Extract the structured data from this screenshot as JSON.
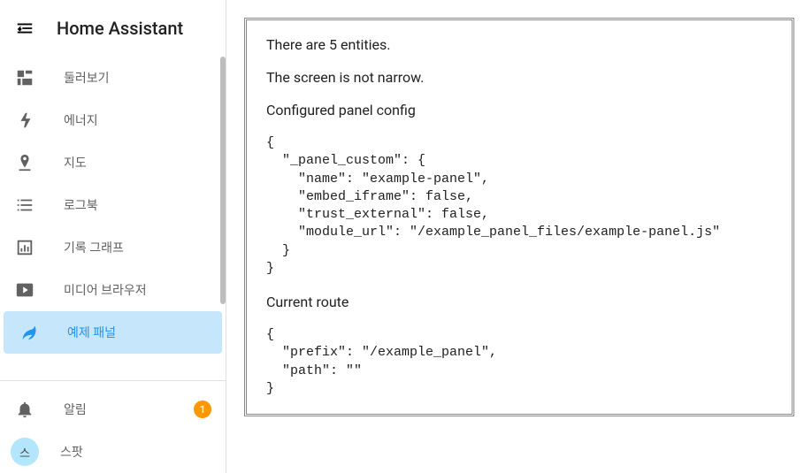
{
  "header": {
    "title": "Home Assistant"
  },
  "sidebar": {
    "items": [
      {
        "label": "둘러보기",
        "icon": "dashboard-icon"
      },
      {
        "label": "에너지",
        "icon": "bolt-icon"
      },
      {
        "label": "지도",
        "icon": "map-icon"
      },
      {
        "label": "로그북",
        "icon": "list-icon"
      },
      {
        "label": "기록 그래프",
        "icon": "chart-icon"
      },
      {
        "label": "미디어 브라우저",
        "icon": "media-icon"
      },
      {
        "label": "예제 패널",
        "icon": "leaf-icon",
        "active": true
      }
    ]
  },
  "bottom": {
    "notifications": {
      "label": "알림",
      "badge": "1"
    },
    "user": {
      "label": "스팟",
      "initial": "스"
    }
  },
  "panel": {
    "line1": "There are 5 entities.",
    "line2": "The screen is not narrow.",
    "config_heading": "Configured panel config",
    "config_json": "{\n  \"_panel_custom\": {\n    \"name\": \"example-panel\",\n    \"embed_iframe\": false,\n    \"trust_external\": false,\n    \"module_url\": \"/example_panel_files/example-panel.js\"\n  }\n}",
    "route_heading": "Current route",
    "route_json": "{\n  \"prefix\": \"/example_panel\",\n  \"path\": \"\"\n}"
  }
}
